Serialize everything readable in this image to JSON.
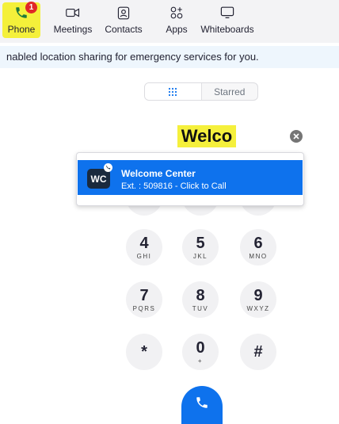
{
  "nav": {
    "items": [
      {
        "label": "Phone",
        "badge": "1"
      },
      {
        "label": "Meetings"
      },
      {
        "label": "Contacts"
      },
      {
        "label": "Apps"
      },
      {
        "label": "Whiteboards"
      }
    ]
  },
  "notice": {
    "text": "nabled location sharing for emergency services for you."
  },
  "tabs": {
    "keypad_icon": "keypad-icon",
    "starred_label": "Starred"
  },
  "dial": {
    "input_value": "Welco"
  },
  "suggestion": {
    "avatar_initials": "WC",
    "name": "Welcome Center",
    "detail": "Ext. : 509816 - Click to Call"
  },
  "keypad": [
    {
      "digit": "4",
      "letters": "GHI"
    },
    {
      "digit": "5",
      "letters": "JKL"
    },
    {
      "digit": "6",
      "letters": "MNO"
    },
    {
      "digit": "7",
      "letters": "PQRS"
    },
    {
      "digit": "8",
      "letters": "TUV"
    },
    {
      "digit": "9",
      "letters": "WXYZ"
    },
    {
      "digit": "*",
      "letters": ""
    },
    {
      "digit": "0",
      "letters": "+"
    },
    {
      "digit": "#",
      "letters": ""
    }
  ],
  "colors": {
    "accent": "#0e72ed",
    "highlight": "#f4f03a",
    "badge": "#e02828"
  }
}
